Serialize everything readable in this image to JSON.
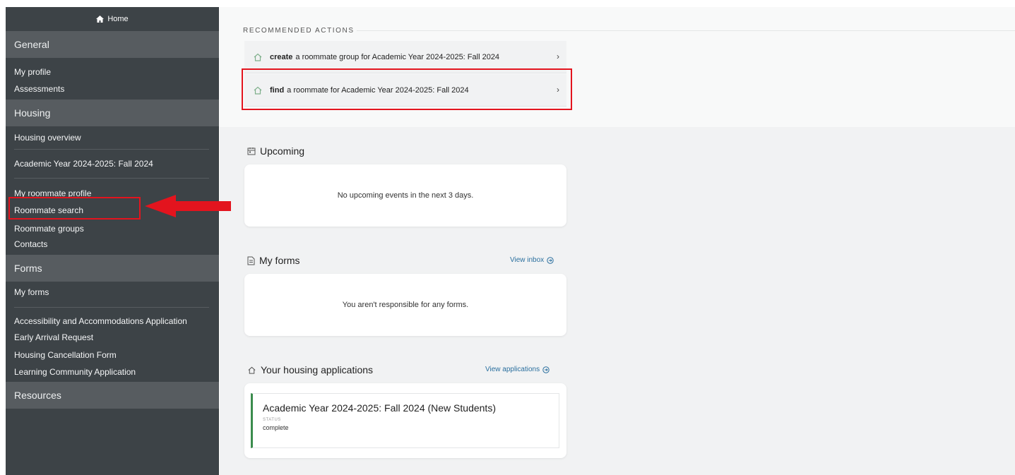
{
  "sidebar": {
    "home_label": "Home",
    "sections": {
      "general": "General",
      "housing": "Housing",
      "forms": "Forms",
      "resources": "Resources"
    },
    "general_items": [
      "My profile",
      "Assessments"
    ],
    "housing_items": {
      "overview": "Housing overview",
      "term": "Academic Year 2024-2025: Fall 2024",
      "roommate_profile": "My roommate profile",
      "roommate_search": "Roommate search",
      "roommate_groups": "Roommate groups",
      "contacts": "Contacts"
    },
    "forms_items": {
      "my_forms": "My forms",
      "accessibility": "Accessibility and Accommodations Application",
      "early_arrival": "Early Arrival Request",
      "cancellation": "Housing Cancellation Form",
      "learning_community": "Learning Community Application"
    }
  },
  "recommended": {
    "title": "RECOMMENDED ACTIONS",
    "actions": [
      {
        "verb": "create",
        "text": "a roommate group for Academic Year 2024-2025: Fall 2024"
      },
      {
        "verb": "find",
        "text": "a roommate for Academic Year 2024-2025: Fall 2024"
      }
    ],
    "chevron": "›"
  },
  "upcoming": {
    "title": "Upcoming",
    "empty_message": "No upcoming events in the next 3 days."
  },
  "my_forms": {
    "title": "My forms",
    "link": "View inbox",
    "empty_message": "You aren't responsible for any forms."
  },
  "housing_apps": {
    "title": "Your housing applications",
    "link": "View applications",
    "application": {
      "title": "Academic Year 2024-2025: Fall 2024 (New Students)",
      "status_label": "STATUS",
      "status": "complete"
    }
  },
  "colors": {
    "sidebar_bg": "#3d4347",
    "section_header_bg": "#575c60",
    "highlight": "#e3141e",
    "link": "#2a6f9e",
    "status_accent": "#3b8c4e"
  },
  "icons": [
    "home-icon",
    "house-icon",
    "chevron-right-icon",
    "calendar-icon",
    "document-icon",
    "arrow-circle-icon",
    "annotation-arrow-icon"
  ]
}
